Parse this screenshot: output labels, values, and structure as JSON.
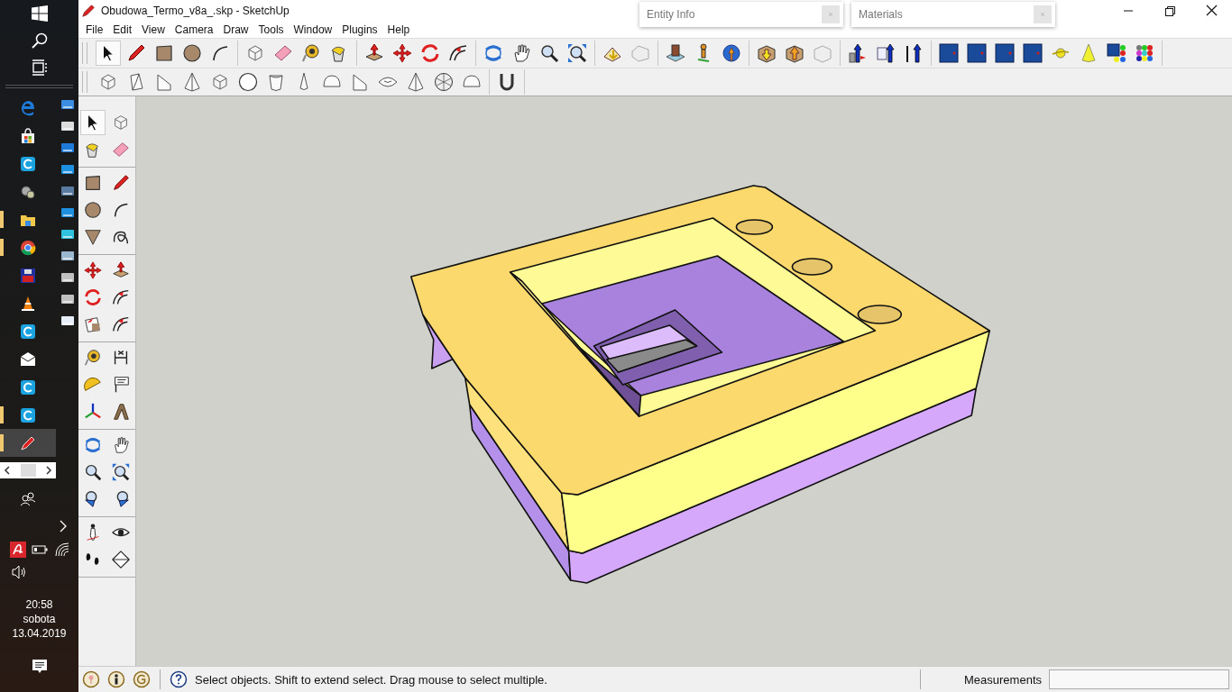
{
  "window": {
    "title": "Obudowa_Termo_v8a_.skp - SketchUp"
  },
  "menu": [
    "File",
    "Edit",
    "View",
    "Camera",
    "Draw",
    "Tools",
    "Window",
    "Plugins",
    "Help"
  ],
  "panels": [
    {
      "title": "Entity Info"
    },
    {
      "title": "Materials"
    }
  ],
  "select_tool": {
    "selected": true
  },
  "taskbar": {
    "apps": [
      {
        "running": false,
        "active": false
      },
      {
        "running": false,
        "active": false
      },
      {
        "running": false,
        "active": false
      },
      {
        "running": false,
        "active": false
      },
      {
        "running": true,
        "active": false
      },
      {
        "running": true,
        "active": false
      },
      {
        "running": false,
        "active": false
      },
      {
        "running": false,
        "active": false
      },
      {
        "running": false,
        "active": false
      },
      {
        "running": false,
        "active": false
      },
      {
        "running": false,
        "active": false
      },
      {
        "running": true,
        "active": false
      },
      {
        "running": true,
        "active": true
      }
    ],
    "time": "20:58",
    "day": "sobota",
    "date": "13.04.2019"
  },
  "status_bar": {
    "hint": "Select objects. Shift to extend select. Drag mouse to select multiple.",
    "measurements_label": "Measurements"
  }
}
